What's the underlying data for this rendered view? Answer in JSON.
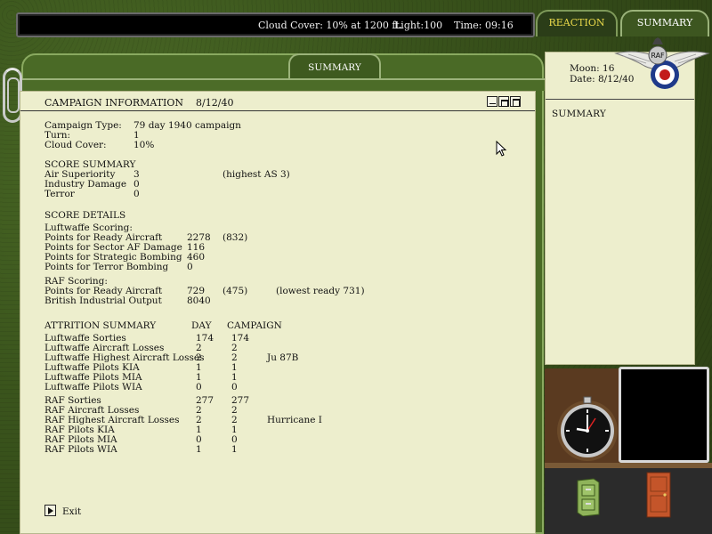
{
  "status": {
    "cloud_cover": "Cloud Cover: 10% at 1200 ft.",
    "light": "Light:100",
    "time": "Time: 09:16"
  },
  "top_tabs": {
    "reaction": "REACTION",
    "summary": "SUMMARY"
  },
  "folder_tab": "SUMMARY",
  "window": {
    "title": "CAMPAIGN INFORMATION",
    "date": "8/12/40"
  },
  "campaign": {
    "type_label": "Campaign Type:",
    "type_value": "79 day 1940 campaign",
    "turn_label": "Turn:",
    "turn_value": "1",
    "cloud_label": "Cloud Cover:",
    "cloud_value": "10%"
  },
  "score_summary": {
    "header": "SCORE SUMMARY",
    "rows": [
      {
        "label": "Air Superiority",
        "value": "3",
        "note": "(highest AS 3)"
      },
      {
        "label": "Industry Damage",
        "value": "0",
        "note": ""
      },
      {
        "label": "Terror",
        "value": "0",
        "note": ""
      }
    ]
  },
  "score_details": {
    "header": "SCORE DETAILS",
    "luftwaffe_header": "Luftwaffe Scoring:",
    "luftwaffe_rows": [
      {
        "label": "Points for Ready Aircraft",
        "value": "2278",
        "extra": "(832)"
      },
      {
        "label": "Points for Sector AF Damage",
        "value": "116",
        "extra": ""
      },
      {
        "label": "Points for Strategic Bombing",
        "value": "460",
        "extra": ""
      },
      {
        "label": "Points for Terror Bombing",
        "value": "0",
        "extra": ""
      }
    ],
    "raf_header": "RAF Scoring:",
    "raf_rows": [
      {
        "label": "Points for Ready Aircraft",
        "value": "729",
        "extra": "(475)",
        "note": "(lowest ready 731)"
      },
      {
        "label": "British Industrial Output",
        "value": "8040",
        "extra": "",
        "note": ""
      }
    ]
  },
  "attrition": {
    "header": "ATTRITION SUMMARY",
    "col_day": "DAY",
    "col_campaign": "CAMPAIGN",
    "luftwaffe_rows": [
      {
        "label": "Luftwaffe Sorties",
        "day": "174",
        "campaign": "174",
        "note": ""
      },
      {
        "label": "Luftwaffe Aircraft Losses",
        "day": "2",
        "campaign": "2",
        "note": ""
      },
      {
        "label": "Luftwaffe Highest Aircraft Losses",
        "day": "2",
        "campaign": "2",
        "note": "Ju 87B"
      },
      {
        "label": "Luftwaffe Pilots KIA",
        "day": "1",
        "campaign": "1",
        "note": ""
      },
      {
        "label": "Luftwaffe Pilots MIA",
        "day": "1",
        "campaign": "1",
        "note": ""
      },
      {
        "label": "Luftwaffe Pilots WIA",
        "day": "0",
        "campaign": "0",
        "note": ""
      }
    ],
    "raf_rows": [
      {
        "label": "RAF Sorties",
        "day": "277",
        "campaign": "277",
        "note": ""
      },
      {
        "label": "RAF Aircraft Losses",
        "day": "2",
        "campaign": "2",
        "note": ""
      },
      {
        "label": "RAF Highest Aircraft Losses",
        "day": "2",
        "campaign": "2",
        "note": "Hurricane I"
      },
      {
        "label": "RAF Pilots KIA",
        "day": "1",
        "campaign": "1",
        "note": ""
      },
      {
        "label": "RAF Pilots MIA",
        "day": "0",
        "campaign": "0",
        "note": ""
      },
      {
        "label": "RAF Pilots WIA",
        "day": "1",
        "campaign": "1",
        "note": ""
      }
    ]
  },
  "exit_label": "Exit",
  "side_panel": {
    "moon": "Moon:  16",
    "date": "Date:  8/12/40",
    "header": "SUMMARY"
  },
  "emblem": {
    "text": "RAF",
    "icon": "raf-wings-emblem-icon"
  },
  "icons": {
    "clock": "clock-icon",
    "cabinet": "file-cabinet-icon",
    "door": "door-icon",
    "exit": "exit-arrow-icon",
    "paperclip": "paperclip-icon"
  },
  "colors": {
    "felt": "#3a541c",
    "paper": "#edeecd",
    "reaction_tab_text": "#e8d84a",
    "status_bar": "#000000"
  }
}
